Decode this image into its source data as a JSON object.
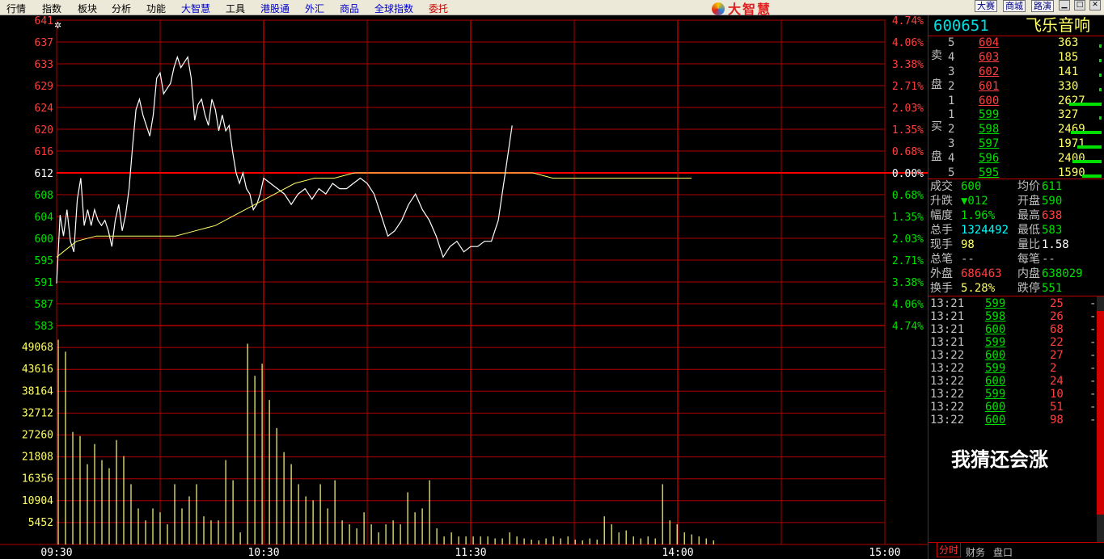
{
  "menu": {
    "items": [
      "行情",
      "指数",
      "板块",
      "分析",
      "功能",
      "大智慧",
      "工具",
      "港股通",
      "外汇",
      "商品",
      "全球指数",
      "委托"
    ],
    "logo": "大智慧",
    "right_buttons": [
      "大赛",
      "商城",
      "路演"
    ]
  },
  "chart": {
    "price_axis": [
      "641",
      "637",
      "633",
      "629",
      "624",
      "620",
      "616",
      "612",
      "608",
      "604",
      "600",
      "595",
      "591",
      "587",
      "583"
    ],
    "percent_axis": [
      "4.74%",
      "4.06%",
      "3.38%",
      "2.71%",
      "2.03%",
      "1.35%",
      "0.68%",
      "0.00%",
      "0.68%",
      "1.35%",
      "2.03%",
      "2.71%",
      "3.38%",
      "4.06%",
      "4.74%"
    ],
    "volume_axis": [
      "49068",
      "43616",
      "38164",
      "32712",
      "27260",
      "21808",
      "16356",
      "10904",
      "5452"
    ],
    "time_axis": [
      "09:30",
      "10:30",
      "11:30",
      "14:00",
      "15:00"
    ],
    "colors": {
      "grid": "#b00000",
      "price_up": "#ff4040",
      "price_down": "#00e000",
      "price_line": "#ffffff",
      "avg_line": "#ffff66",
      "volume": "#ffff80",
      "base": "#ff0000"
    }
  },
  "chart_data": {
    "type": "line",
    "title": "",
    "xlabel": "",
    "ylabel": "",
    "ylim": [
      5.83,
      6.41
    ],
    "prev_close": 6.12,
    "x_ticks": [
      "09:30",
      "10:30",
      "11:30",
      "14:00",
      "15:00"
    ],
    "series": [
      {
        "name": "",
        "kind": "price",
        "x_minutes": [
          0,
          1,
          2,
          3,
          4,
          5,
          6,
          7,
          8,
          9,
          10,
          11,
          12,
          13,
          14,
          15,
          16,
          17,
          18,
          19,
          20,
          21,
          22,
          23,
          24,
          25,
          26,
          27,
          28,
          29,
          30,
          31,
          32,
          33,
          34,
          35,
          36,
          37,
          38,
          39,
          40,
          41,
          42,
          43,
          44,
          45,
          46,
          47,
          48,
          49,
          50,
          51,
          52,
          53,
          54,
          55,
          56,
          57,
          58,
          59,
          60,
          62,
          64,
          66,
          68,
          70,
          72,
          74,
          76,
          78,
          80,
          82,
          84,
          86,
          88,
          90,
          92,
          94,
          96,
          98,
          100,
          102,
          104,
          106,
          108,
          110,
          112,
          114,
          116,
          118,
          120,
          122,
          124,
          126,
          128,
          130,
          132,
          134,
          136,
          138,
          140,
          142,
          144,
          146,
          148,
          150,
          152,
          154,
          156,
          158,
          160,
          162,
          164,
          166,
          168,
          170,
          172,
          174,
          176,
          178,
          180,
          182,
          184,
          186,
          188,
          190,
          192
        ],
        "values": [
          5.91,
          6.04,
          6.0,
          6.05,
          5.99,
          5.97,
          6.07,
          6.11,
          6.02,
          6.05,
          6.02,
          6.05,
          6.03,
          6.02,
          6.03,
          6.01,
          5.98,
          6.03,
          6.06,
          6.01,
          6.04,
          6.09,
          6.17,
          6.24,
          6.26,
          6.23,
          6.21,
          6.19,
          6.23,
          6.3,
          6.31,
          6.27,
          6.28,
          6.29,
          6.32,
          6.34,
          6.32,
          6.33,
          6.34,
          6.3,
          6.22,
          6.25,
          6.26,
          6.23,
          6.21,
          6.26,
          6.24,
          6.2,
          6.23,
          6.2,
          6.21,
          6.16,
          6.12,
          6.1,
          6.12,
          6.09,
          6.08,
          6.05,
          6.06,
          6.08,
          6.11,
          6.1,
          6.09,
          6.08,
          6.06,
          6.08,
          6.09,
          6.07,
          6.09,
          6.08,
          6.1,
          6.09,
          6.09,
          6.1,
          6.11,
          6.1,
          6.08,
          6.04,
          6.0,
          6.01,
          6.03,
          6.06,
          6.08,
          6.05,
          6.03,
          6.0,
          5.96,
          5.98,
          5.99,
          5.97,
          5.98,
          5.98,
          5.99,
          5.99,
          6.03,
          6.12,
          6.21
        ]
      },
      {
        "name": "",
        "kind": "average",
        "values": [
          5.96,
          5.99,
          6.0,
          6.0,
          6.0,
          6.0,
          6.0,
          6.01,
          6.02,
          6.04,
          6.06,
          6.08,
          6.1,
          6.11,
          6.11,
          6.12,
          6.12,
          6.12,
          6.12,
          6.12,
          6.12,
          6.12,
          6.12,
          6.12,
          6.12,
          6.11,
          6.11,
          6.11,
          6.11,
          6.11,
          6.11,
          6.11,
          6.11
        ]
      },
      {
        "name": "",
        "kind": "volume",
        "values": [
          51000,
          48000,
          28000,
          27000,
          20000,
          25000,
          21000,
          19000,
          26000,
          22000,
          15000,
          9000,
          6000,
          9000,
          8000,
          5000,
          15000,
          9000,
          12000,
          15000,
          7000,
          6000,
          6000,
          21000,
          16000,
          3000,
          50000,
          42000,
          45000,
          36000,
          29000,
          23000,
          20000,
          15000,
          12000,
          11000,
          15000,
          9000,
          16000,
          6000,
          5000,
          4000,
          8000,
          5000,
          3000,
          5000,
          6000,
          5000,
          13000,
          8000,
          9000,
          16000,
          4000,
          2000,
          3000,
          2000,
          2000,
          2000,
          2000,
          2000,
          1500,
          1500,
          3000,
          2000,
          1500,
          1200,
          1000,
          1500,
          2000,
          1500,
          2000,
          1200,
          1000,
          1500,
          1200,
          7000,
          5000,
          3000,
          3500,
          2000,
          1500,
          2000,
          1500,
          15000,
          6000,
          5000,
          3000,
          2500,
          2000,
          1500,
          1000
        ]
      }
    ]
  },
  "panel": {
    "code": "600651",
    "name": "飞乐音响",
    "sell_label": [
      "卖",
      "盘"
    ],
    "buy_label": [
      "买",
      "盘"
    ],
    "sell": [
      {
        "level": "5",
        "price": "604",
        "vol": "363",
        "bar": 0.05
      },
      {
        "level": "4",
        "price": "603",
        "vol": "185",
        "bar": 0.03
      },
      {
        "level": "3",
        "price": "602",
        "vol": "141",
        "bar": 0.02
      },
      {
        "level": "2",
        "price": "601",
        "vol": "330",
        "bar": 0.04
      },
      {
        "level": "1",
        "price": "600",
        "vol": "2627",
        "bar": 1.0
      }
    ],
    "buy": [
      {
        "level": "1",
        "price": "599",
        "vol": "327",
        "bar": 0.05
      },
      {
        "level": "2",
        "price": "598",
        "vol": "2469",
        "bar": 0.94
      },
      {
        "level": "3",
        "price": "597",
        "vol": "1971",
        "bar": 0.75
      },
      {
        "level": "4",
        "price": "596",
        "vol": "2400",
        "bar": 0.91
      },
      {
        "level": "5",
        "price": "595",
        "vol": "1590",
        "bar": 0.61
      }
    ],
    "stats": [
      {
        "l1": "成交",
        "v1": "600",
        "l2": "均价",
        "v2": "611"
      },
      {
        "l1": "升跌",
        "v1": "▼012",
        "l2": "开盘",
        "v2": "590"
      },
      {
        "l1": "幅度",
        "v1": "1.96%",
        "l2": "最高",
        "v2": "638"
      },
      {
        "l1": "总手",
        "v1": "1324492",
        "l2": "最低",
        "v2": "583"
      },
      {
        "l1": "现手",
        "v1": "98",
        "l2": "量比",
        "v2": "1.58"
      },
      {
        "l1": "总笔",
        "v1": "--",
        "l2": "每笔",
        "v2": "--"
      },
      {
        "l1": "外盘",
        "v1": "686463",
        "l2": "内盘",
        "v2": "638029"
      },
      {
        "l1": "换手",
        "v1": "5.28%",
        "l2": "跌停",
        "v2": "551"
      }
    ],
    "ticks": [
      {
        "time": "13:21",
        "price": "599",
        "vol": "25"
      },
      {
        "time": "13:21",
        "price": "598",
        "vol": "26"
      },
      {
        "time": "13:21",
        "price": "600",
        "vol": "68"
      },
      {
        "time": "13:21",
        "price": "599",
        "vol": "22"
      },
      {
        "time": "13:22",
        "price": "600",
        "vol": "27"
      },
      {
        "time": "13:22",
        "price": "599",
        "vol": "2"
      },
      {
        "time": "13:22",
        "price": "600",
        "vol": "24"
      },
      {
        "time": "13:22",
        "price": "599",
        "vol": "10"
      },
      {
        "time": "13:22",
        "price": "600",
        "vol": "51"
      },
      {
        "time": "13:22",
        "price": "600",
        "vol": "98"
      }
    ],
    "comment": "我猜还会涨",
    "tabs": [
      "分时",
      "财务",
      "盘口"
    ]
  }
}
